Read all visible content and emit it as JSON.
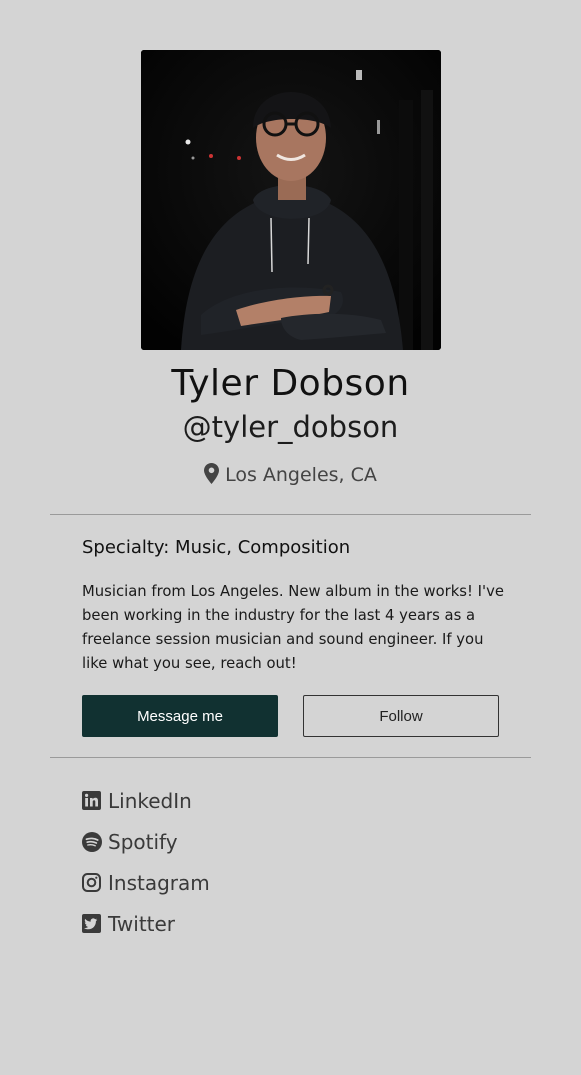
{
  "profile": {
    "photo_alt": "Tyler Dobson",
    "name": "Tyler Dobson",
    "handle": "@tyler_dobson",
    "location": "Los Angeles, CA",
    "specialty": "Specialty: Music, Composition",
    "bio": "Musician from Los Angeles. New album in the works! I've been working in the industry for the last 4 years as a freelance session musician and sound engineer. If you like what you see, reach out!"
  },
  "actions": {
    "message_label": "Message me",
    "follow_label": "Follow"
  },
  "social": [
    {
      "label": "LinkedIn",
      "icon": "linkedin-icon"
    },
    {
      "label": "Spotify",
      "icon": "spotify-icon"
    },
    {
      "label": "Instagram",
      "icon": "instagram-icon"
    },
    {
      "label": "Twitter",
      "icon": "twitter-icon"
    }
  ],
  "colors": {
    "background": "#d4d4d4",
    "primary_button": "#113131",
    "divider": "#9a9a9a"
  }
}
